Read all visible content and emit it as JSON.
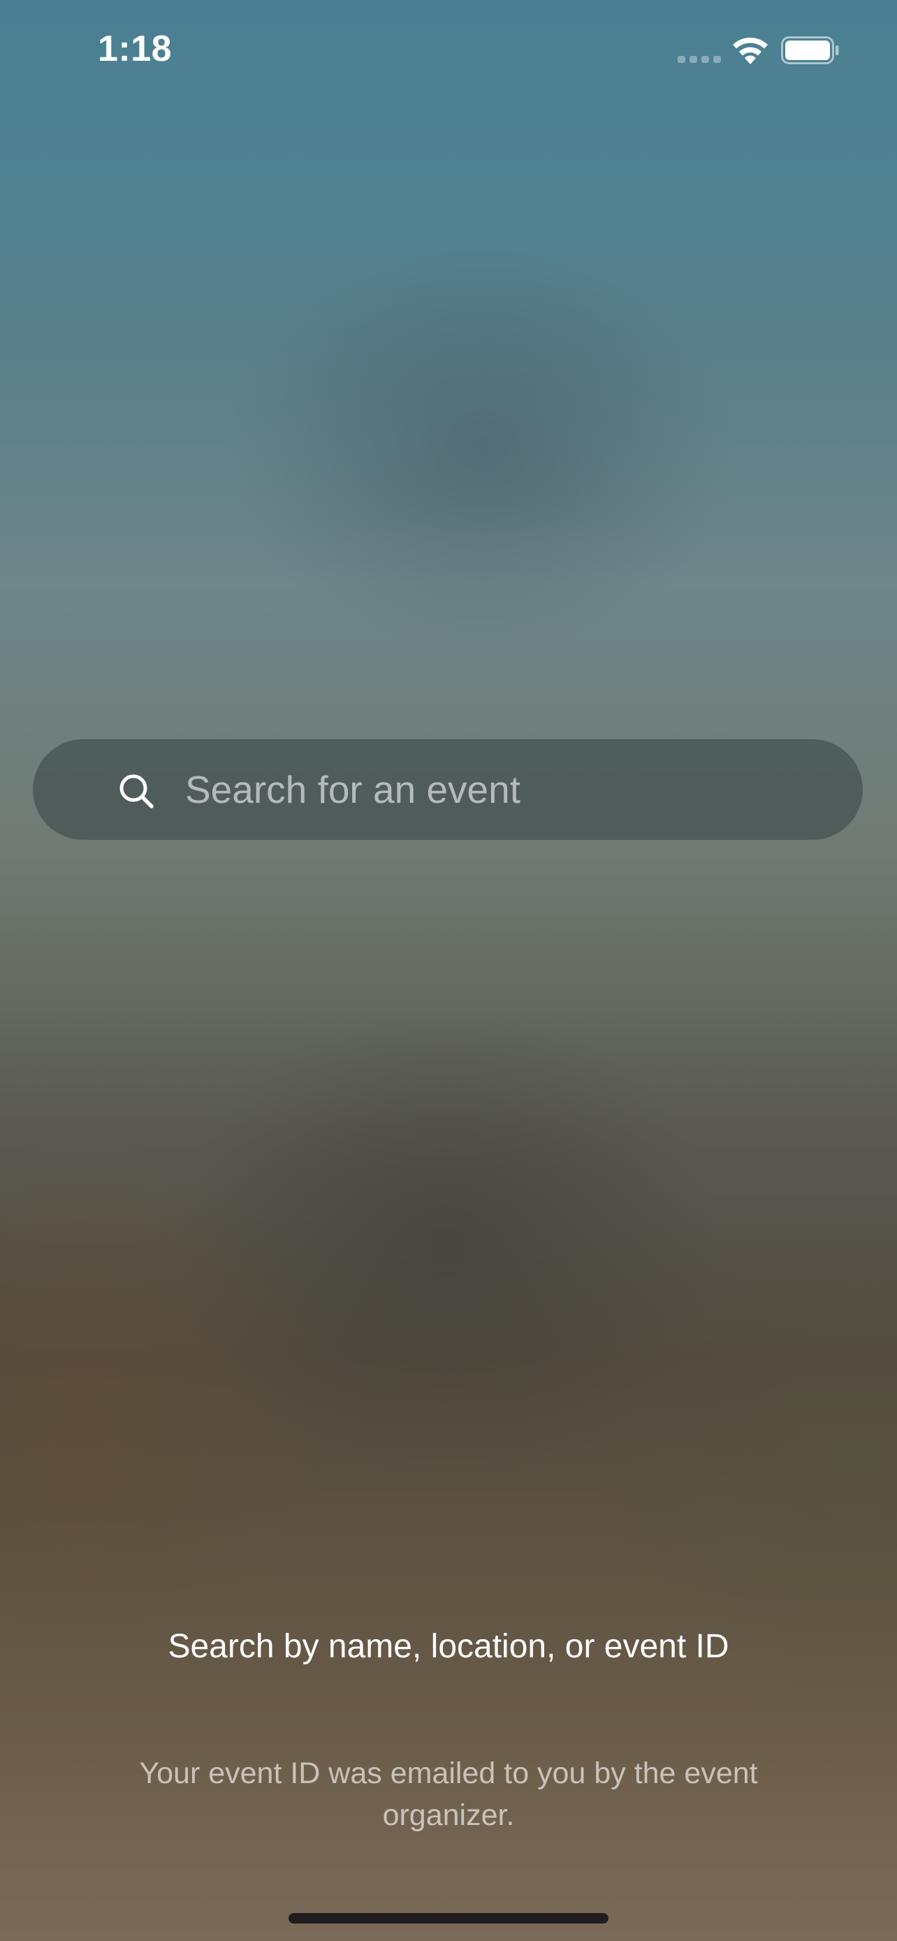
{
  "status_bar": {
    "time": "1:18",
    "icons": [
      "cellular-signal-icon",
      "wifi-icon",
      "battery-icon"
    ]
  },
  "search": {
    "placeholder": "Search for an event",
    "value": "",
    "icon": "search-icon"
  },
  "helper": {
    "title": "Search by name, location, or event ID",
    "subtitle": "Your event ID was emailed to you by the event organizer."
  },
  "colors": {
    "text_primary": "#ffffff",
    "search_bar_bg": "#3e484a",
    "home_indicator": "#1e1e1e"
  }
}
